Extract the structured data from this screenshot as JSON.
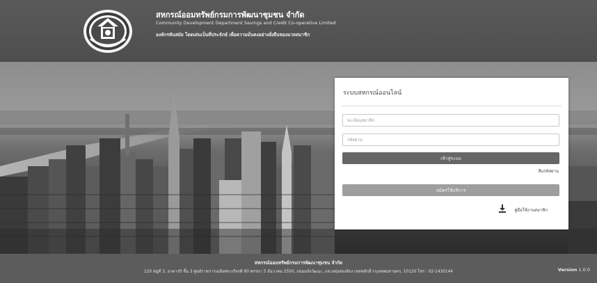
{
  "header": {
    "org_name_th": "สหกรณ์ออมทรัพย์กรมการพัฒนาชุมชน จำกัด",
    "org_name_en": "Community Development Department Savings and Credit Co-operative Limited",
    "slogan": "องค์กรทันสมัย โดดเด่นเป็นที่ประจักษ์ เพื่อความมั่นคงอย่างยั่งยืนของมวลสมาชิก",
    "logo_icon": "cooperative-seal-logo"
  },
  "login": {
    "title": "ระบบสหกรณ์ออนไลน์",
    "username_placeholder": "ทะเบียนสมาชิก",
    "password_placeholder": "รหัสผ่าน",
    "login_button": "เข้าสู่ระบบ",
    "forgot_password": "ลืมรหัสผ่าน",
    "register_button": "สมัครใช้บริการ",
    "manual_link": "คู่มือใช้งานสมาชิก",
    "manual_icon": "download-icon"
  },
  "footer": {
    "org_name": "สหกรณ์ออมทรัพย์กรมการพัฒนาชุมชน จำกัด",
    "address": "120 หมู่ที่ 3, อาคารบี ชั้น 3 ศูนย์ราชการเฉลิมพระเกียรติ 80 พรรษา 5 ธันวาคม 2550, ถนนแจ้งวัฒนะ, แขวงทุ่งสองห้อง เขตหลักสี่ กรุงเทพมหานคร, 10120 โทร : 02-1430144",
    "version_label": "Version",
    "version_number": "1.0.0"
  }
}
